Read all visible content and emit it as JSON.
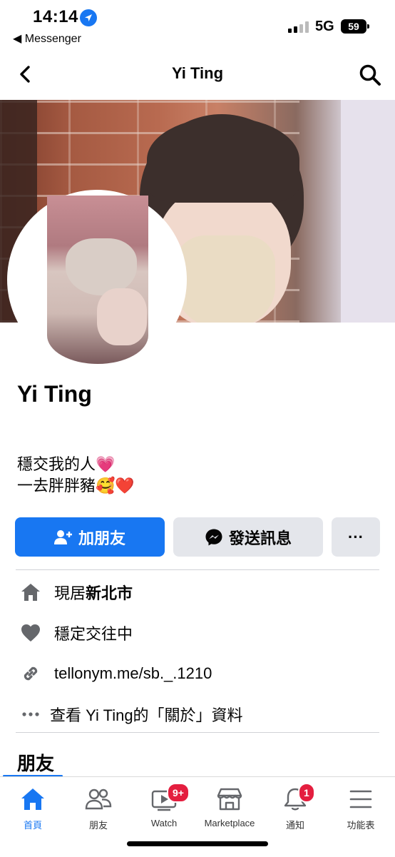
{
  "status_bar": {
    "time": "14:14",
    "back_app": "◀ Messenger",
    "network": "5G",
    "battery": "59"
  },
  "nav": {
    "title": "Yi Ting",
    "back_icon": "chevron-left-icon",
    "search_icon": "search-icon"
  },
  "profile": {
    "name": "Yi Ting",
    "bio_line1": "穩交我的人💗",
    "bio_line2": "一去胖胖豬🥰❤️"
  },
  "actions": {
    "add_friend": "加朋友",
    "send_message": "發送訊息",
    "more": "···"
  },
  "intro": {
    "lives_prefix": "現居",
    "lives_city": "新北市",
    "relationship": "穩定交往中",
    "link": "tellonym.me/sb._.1210",
    "see_about": "查看 Yi Ting的「關於」資料"
  },
  "friends_title": "朋友",
  "tabs": [
    {
      "label": "首頁",
      "icon": "home-icon",
      "active": true
    },
    {
      "label": "朋友",
      "icon": "friends-icon",
      "active": false
    },
    {
      "label": "Watch",
      "icon": "watch-icon",
      "badge": "9+"
    },
    {
      "label": "Marketplace",
      "icon": "marketplace-icon"
    },
    {
      "label": "通知",
      "icon": "bell-icon",
      "badge": "1"
    },
    {
      "label": "功能表",
      "icon": "menu-icon"
    }
  ],
  "colors": {
    "accent": "#1877f2",
    "badge": "#e41e3f",
    "secondary_button": "#e4e6eb"
  }
}
